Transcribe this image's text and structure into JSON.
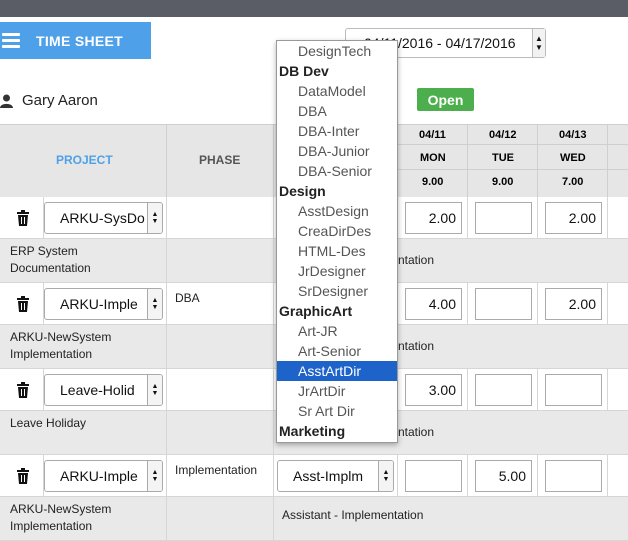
{
  "header": {
    "title": "TIME SHEET",
    "week_range": "04/11/2016 - 04/17/2016"
  },
  "user": {
    "name": "Gary Aaron"
  },
  "status": {
    "label": "Open",
    "color": "#4cae4c"
  },
  "columns": {
    "project": "PROJECT",
    "phase": "PHASE",
    "days": [
      {
        "date": "04/11",
        "day": "MON",
        "total": "9.00"
      },
      {
        "date": "04/12",
        "day": "TUE",
        "total": "9.00"
      },
      {
        "date": "04/13",
        "day": "WED",
        "total": "7.00"
      }
    ]
  },
  "rows": [
    {
      "project": "ARKU-SysDo",
      "phase": "",
      "role": "",
      "hours": [
        "2.00",
        "",
        "2.00"
      ],
      "description": "ERP System Documentation",
      "role_desc": "ntation"
    },
    {
      "project": "ARKU-Imple",
      "phase": "DBA",
      "role": "",
      "hours": [
        "4.00",
        "",
        "2.00"
      ],
      "description": "ARKU-NewSystem Implementation",
      "role_desc": "ntation"
    },
    {
      "project": "Leave-Holid",
      "phase": "",
      "role": "",
      "hours": [
        "3.00",
        "",
        ""
      ],
      "description": "Leave Holiday",
      "role_desc": "ntation"
    },
    {
      "project": "ARKU-Imple",
      "phase": "Implementation",
      "role": "Asst-Implm",
      "hours": [
        "",
        "5.00",
        ""
      ],
      "description": "ARKU-NewSystem Implementation",
      "role_desc": "Assistant - Implementation"
    }
  ],
  "dropdown": {
    "items": [
      {
        "type": "item",
        "label": "DesignTech"
      },
      {
        "type": "group",
        "label": "DB Dev"
      },
      {
        "type": "item",
        "label": "DataModel"
      },
      {
        "type": "item",
        "label": "DBA"
      },
      {
        "type": "item",
        "label": "DBA-Inter"
      },
      {
        "type": "item",
        "label": "DBA-Junior"
      },
      {
        "type": "item",
        "label": "DBA-Senior"
      },
      {
        "type": "group",
        "label": "Design"
      },
      {
        "type": "item",
        "label": "AsstDesign"
      },
      {
        "type": "item",
        "label": "CreaDirDes"
      },
      {
        "type": "item",
        "label": "HTML-Des"
      },
      {
        "type": "item",
        "label": "JrDesigner"
      },
      {
        "type": "item",
        "label": "SrDesigner"
      },
      {
        "type": "group",
        "label": "GraphicArt"
      },
      {
        "type": "item",
        "label": "Art-JR"
      },
      {
        "type": "item",
        "label": "Art-Senior"
      },
      {
        "type": "item",
        "label": "AsstArtDir",
        "highlighted": true
      },
      {
        "type": "item",
        "label": "JrArtDir"
      },
      {
        "type": "item",
        "label": "Sr Art Dir"
      },
      {
        "type": "group",
        "label": "Marketing"
      }
    ]
  },
  "colors": {
    "accent": "#4ea1e8",
    "highlight": "#1e63c9",
    "header_bg": "#e6e6e6"
  }
}
